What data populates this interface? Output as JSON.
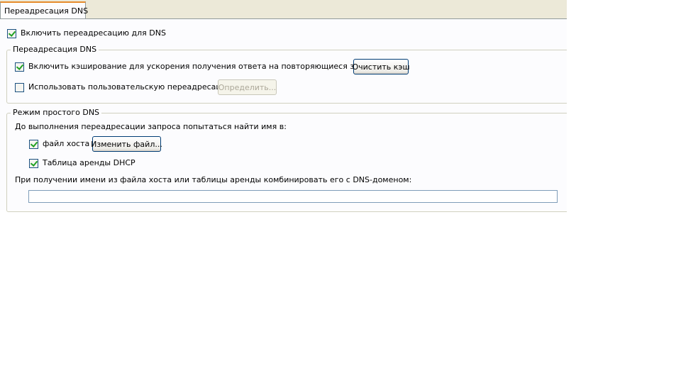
{
  "tab": {
    "label": "Переадресация DNS"
  },
  "enable_forwarding": {
    "label": "Включить переадресацию для DNS",
    "checked": true
  },
  "forwarding_group": {
    "legend": "Переадресация DNS",
    "caching": {
      "label": "Включить кэширование для ускорения получения ответа на повторяющиеся запросы.",
      "checked": true
    },
    "clear_cache_button": "Очистить кэш",
    "custom_forwarding": {
      "label": "Использовать пользовательскую переадресацию",
      "checked": false
    },
    "define_button": "Определить..."
  },
  "simple_dns_group": {
    "legend": "Режим простого DNS",
    "lookup_intro": "До выполнения переадресации запроса попытаться найти имя в:",
    "hosts_file": {
      "label": "файл хоста",
      "checked": true
    },
    "edit_file_button": "Изменить файл...",
    "dhcp_lease": {
      "label": "Таблица аренды DHCP",
      "checked": true
    },
    "domain_combine_label": "При получении имени из файла хоста или таблицы аренды комбинировать его с DNS-доменом:",
    "domain_input_value": ""
  },
  "colors": {
    "tab_strip": "#ece9d8",
    "panel": "#fcfcfe",
    "tab_accent": "#e68b2c",
    "checkmark": "#21a121",
    "button_border": "#003c74"
  }
}
